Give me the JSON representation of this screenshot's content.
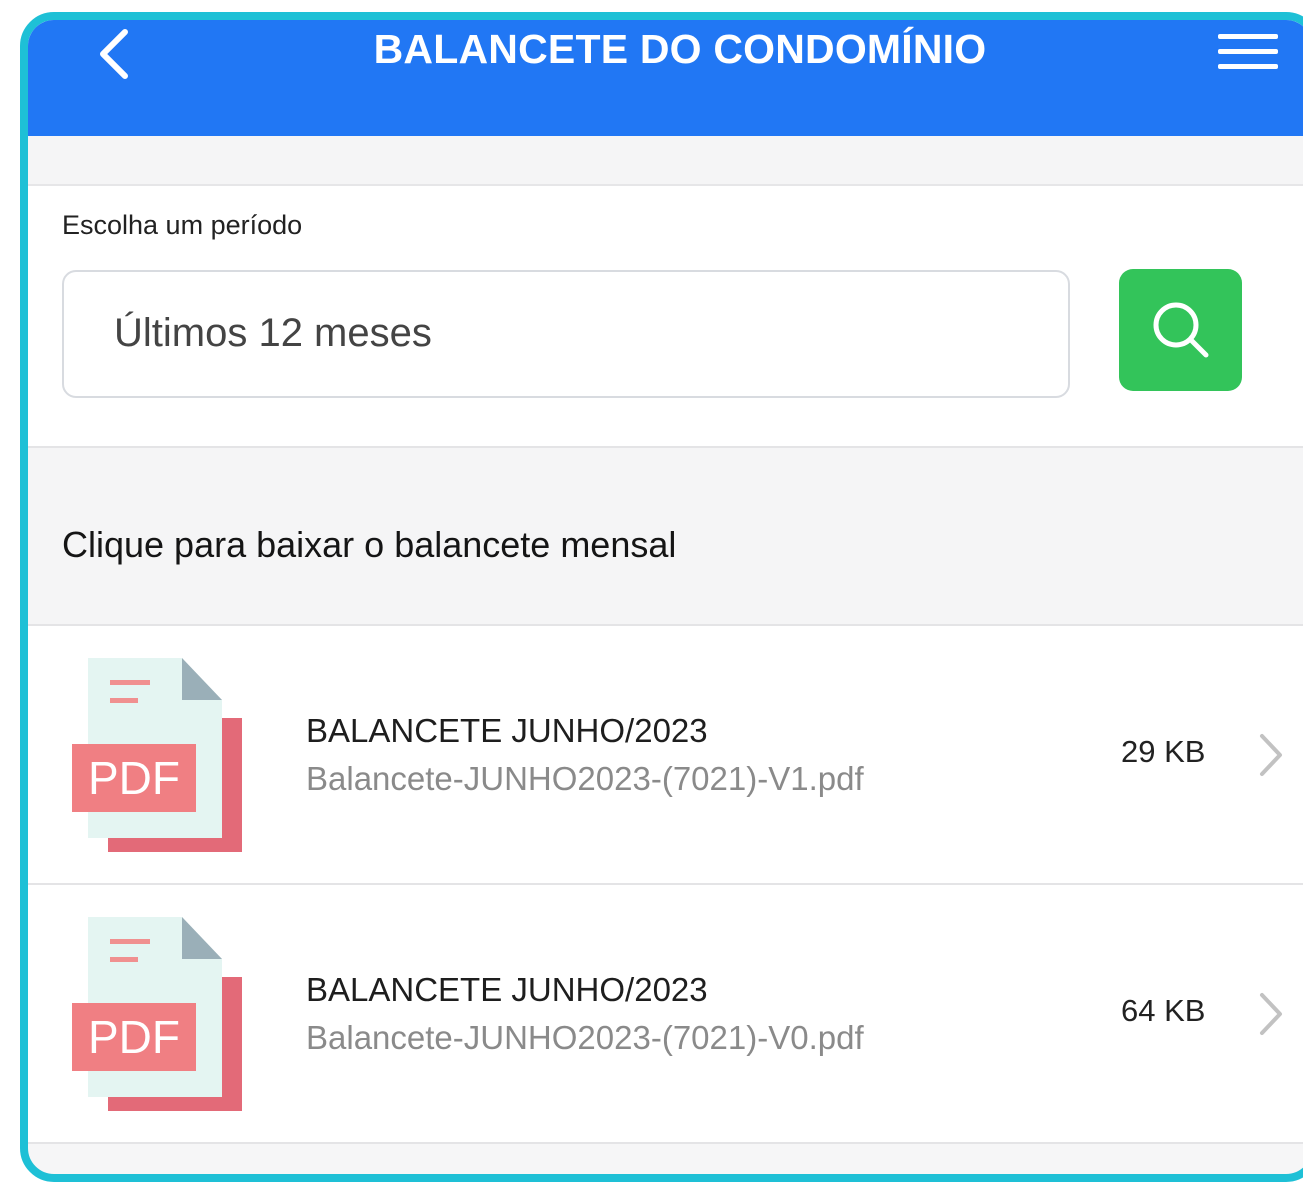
{
  "header": {
    "title": "BALANCETE DO CONDOMÍNIO",
    "back_icon": "chevron-left-icon",
    "menu_icon": "hamburger-menu-icon",
    "bg_color": "#2177f4"
  },
  "filter": {
    "label": "Escolha um período",
    "selected_period": "Últimos 12 meses",
    "search_icon": "search-icon",
    "search_color": "#33c45a"
  },
  "section": {
    "title": "Clique para baixar o balancete mensal"
  },
  "files": [
    {
      "icon_label": "PDF",
      "name": "BALANCETE JUNHO/2023",
      "filename": "Balancete-JUNHO2023-(7021)-V1.pdf",
      "size": "29 KB"
    },
    {
      "icon_label": "PDF",
      "name": "BALANCETE JUNHO/2023",
      "filename": "Balancete-JUNHO2023-(7021)-V0.pdf",
      "size": "64 KB"
    }
  ]
}
